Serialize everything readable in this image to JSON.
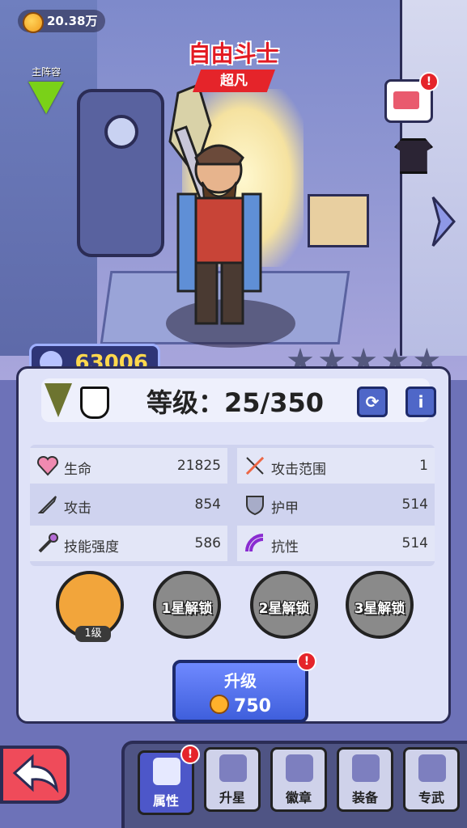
{
  "currency": {
    "amount": "20.38万"
  },
  "formation": {
    "label": "主阵容"
  },
  "hero": {
    "name": "自由斗士",
    "rarity": "超凡"
  },
  "power": {
    "value": "63006"
  },
  "stars": {
    "filled": 0,
    "total": 5
  },
  "level": {
    "text": "等级：25/350"
  },
  "stats": [
    {
      "label": "生命",
      "value": "21825",
      "icon": "heart-icon"
    },
    {
      "label": "攻击范围",
      "value": "1",
      "icon": "range-icon"
    },
    {
      "label": "攻击",
      "value": "854",
      "icon": "sword-icon"
    },
    {
      "label": "护甲",
      "value": "514",
      "icon": "shield-icon"
    },
    {
      "label": "技能强度",
      "value": "586",
      "icon": "wand-icon"
    },
    {
      "label": "抗性",
      "value": "514",
      "icon": "resist-icon"
    }
  ],
  "skills": [
    {
      "label": "",
      "level": "1级"
    },
    {
      "label": "1星解锁"
    },
    {
      "label": "2星解锁"
    },
    {
      "label": "3星解锁"
    }
  ],
  "upgrade": {
    "title": "升级",
    "cost": "750"
  },
  "tabs": [
    {
      "label": "属性",
      "active": true
    },
    {
      "label": "升星"
    },
    {
      "label": "徽章"
    },
    {
      "label": "装备"
    },
    {
      "label": "专武"
    }
  ],
  "colors": {
    "accent": "#4d57c9",
    "alert": "#e5242a",
    "power": "#ffd84d"
  }
}
